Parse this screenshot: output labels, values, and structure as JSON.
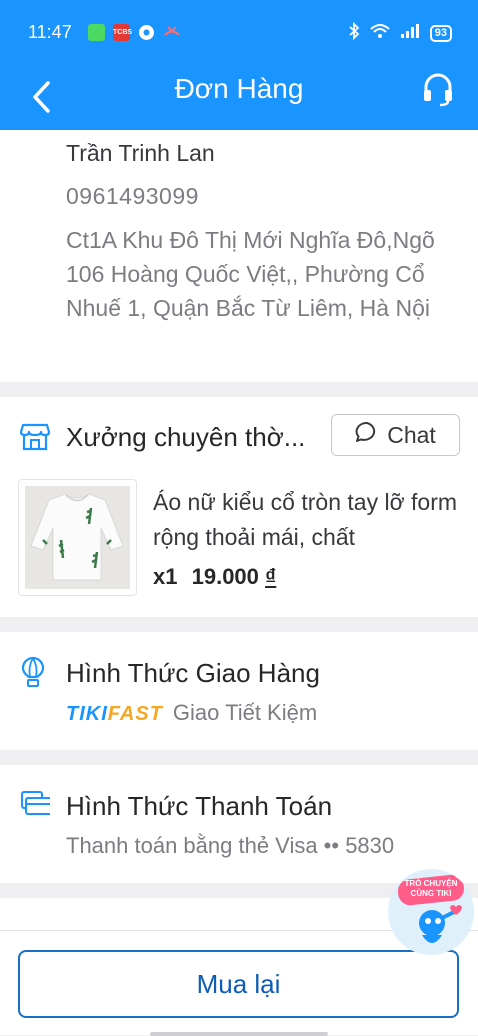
{
  "status_bar": {
    "time": "11:47",
    "battery": "93",
    "app_icons": [
      "messages-app-icon",
      "tcbs-app-icon",
      "chrome-app-icon",
      "missed-call-icon"
    ],
    "tcbs_label": "TCBS"
  },
  "header": {
    "title": "Đơn Hàng",
    "back_icon": "back-arrow-icon",
    "support_icon": "headset-icon"
  },
  "address": {
    "name": "Trần Trinh Lan",
    "phone": "0961493099",
    "street": "Ct1A Khu Đô Thị Mới Nghĩa Đô,Ngõ 106 Hoàng Quốc Việt,, Phường Cổ Nhuế 1, Quận Bắc Từ Liêm, Hà Nội"
  },
  "shop": {
    "name": "Xưởng chuyên thờ...",
    "chat_label": "Chat",
    "product_name": "Áo nữ kiểu cổ tròn tay lỡ form rộng thoải mái, chất",
    "quantity": "x1",
    "price": "19.000",
    "currency": "₫"
  },
  "shipping": {
    "title": "Hình Thức Giao Hàng",
    "logo_part1": "TIKI",
    "logo_part2": "FAST",
    "method": "Giao Tiết Kiệm"
  },
  "payment": {
    "title": "Hình Thức Thanh Toán",
    "method": "Thanh toán bằng thẻ Visa •• 5830"
  },
  "chat_bubble": {
    "text": "TRÒ CHUYỆN CÙNG TIKI"
  },
  "footer": {
    "rebuy_label": "Mua lại"
  },
  "colors": {
    "brand_blue": "#1a94ff",
    "button_blue": "#0d5cb6",
    "tikifast_orange": "#f5a623"
  }
}
